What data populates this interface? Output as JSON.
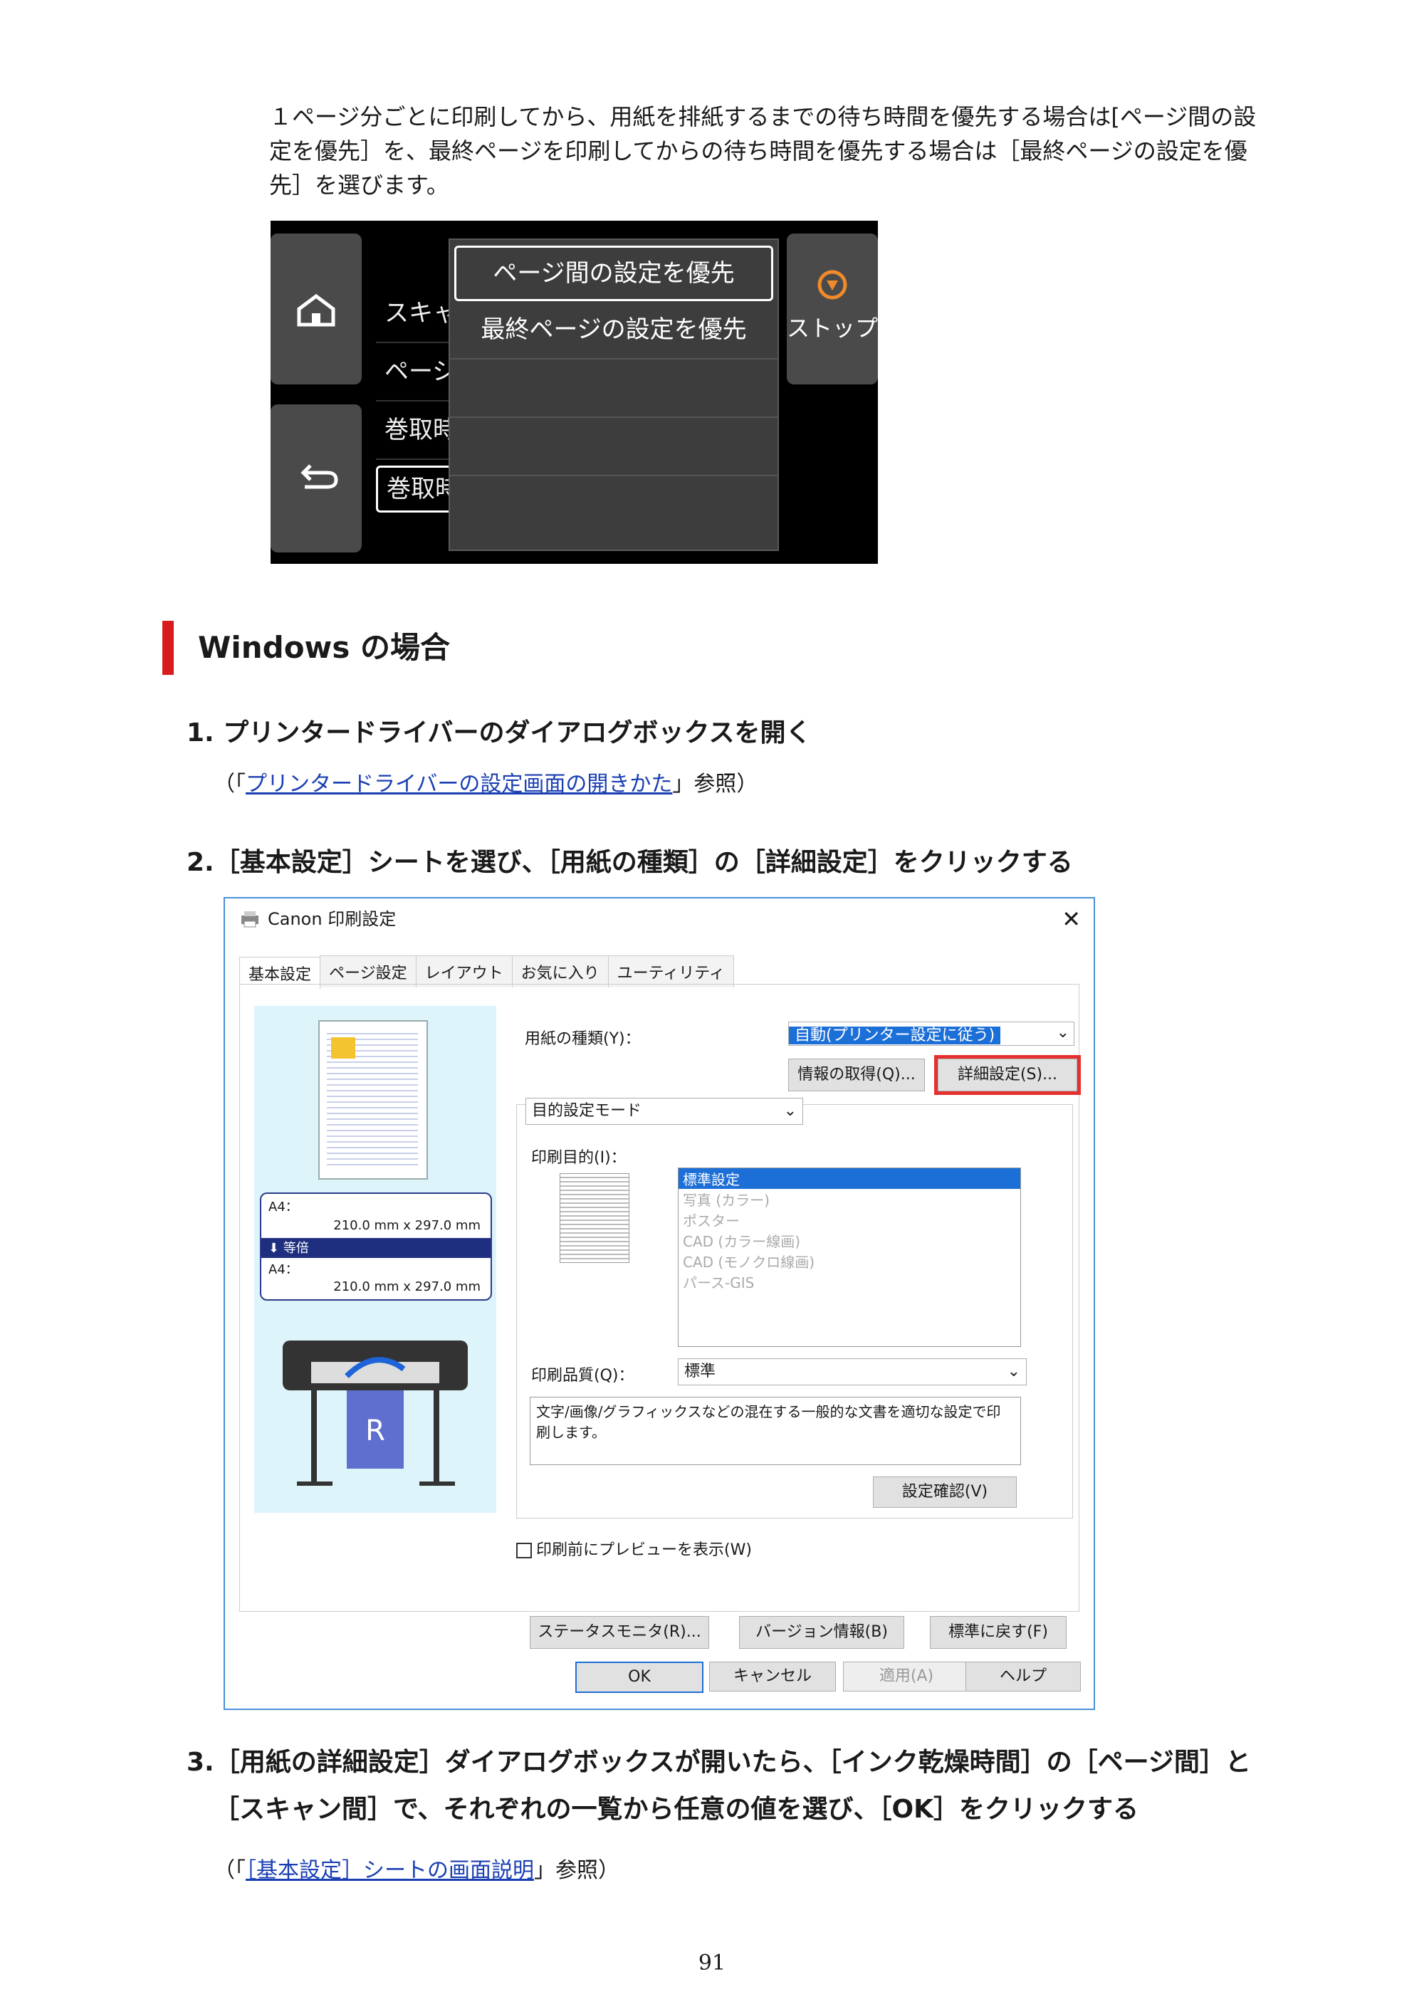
{
  "intro": {
    "line1": "１ページ分ごとに印刷してから、用紙を排紙するまでの待ち時間を優先する場合は[ページ間の設",
    "line2": "定を優先］を、最終ページを印刷してからの待ち時間を優先する場合は［最終ページの設定を優",
    "line3": "先］を選びます。"
  },
  "panel": {
    "stop_label": "ストップ",
    "rows": [
      "スキャ",
      "ページ",
      "巻取時",
      "巻取時"
    ],
    "options": [
      "ページ間の設定を優先",
      "最終ページの設定を優先"
    ]
  },
  "section_title": "Windows の場合",
  "steps": {
    "s1": "1.  プリンタードライバーのダイアログボックスを開く",
    "s1_ref_open": "（「",
    "s1_ref_link": "プリンタードライバーの設定画面の開きかた",
    "s1_ref_close": "」参照）",
    "s2": "2.［基本設定］シートを選び、［用紙の種類］の［詳細設定］をクリックする",
    "s3_line1": "3.［用紙の詳細設定］ダイアログボックスが開いたら、［インク乾燥時間］の［ページ間］と",
    "s3_line2": "［スキャン間］で、それぞれの一覧から任意の値を選び、［OK］をクリックする",
    "s3_ref_open": "（「",
    "s3_ref_link": "［基本設定］シートの画面説明",
    "s3_ref_close": "」参照）"
  },
  "dialog": {
    "title": "Canon   印刷設定",
    "tabs": [
      "基本設定",
      "ページ設定",
      "レイアウト",
      "お気に入り",
      "ユーティリティ"
    ],
    "media_label": "用紙の種類(Y)：",
    "media_value": "自動(プリンター設定に従う)",
    "get_info": "情報の取得(Q)...",
    "adv_settings": "詳細設定(S)...",
    "mode": "目的設定モード",
    "purpose_label": "印刷目的(I)：",
    "purposes": [
      "標準設定",
      "写真 (カラー)",
      "ポスター",
      "CAD (カラー線画)",
      "CAD (モノクロ線画)",
      "パース-GIS"
    ],
    "quality_label": "印刷品質(Q)：",
    "quality_value": "標準",
    "desc": "文字/画像/グラフィックスなどの混在する一般的な文書を適切な設定で印刷します。",
    "confirm": "設定確認(V)",
    "preview_check": "印刷前にプレビューを表示(W)",
    "status": "ステータスモニタ(R)...",
    "version": "バージョン情報(B)",
    "defaults": "標準に戻す(F)",
    "ok": "OK",
    "cancel": "キャンセル",
    "apply": "適用(A)",
    "help": "ヘルプ",
    "paper_a4_1": "A4：",
    "paper_size_1": "210.0 mm x 297.0 mm",
    "scale": "等倍",
    "paper_a4_2": "A4：",
    "paper_size_2": "210.0 mm x 297.0 mm"
  },
  "page_number": "91",
  "colors": {
    "heading_bar": "#d81c1c",
    "link": "#1a3fb3",
    "highlight": "#e53030"
  }
}
